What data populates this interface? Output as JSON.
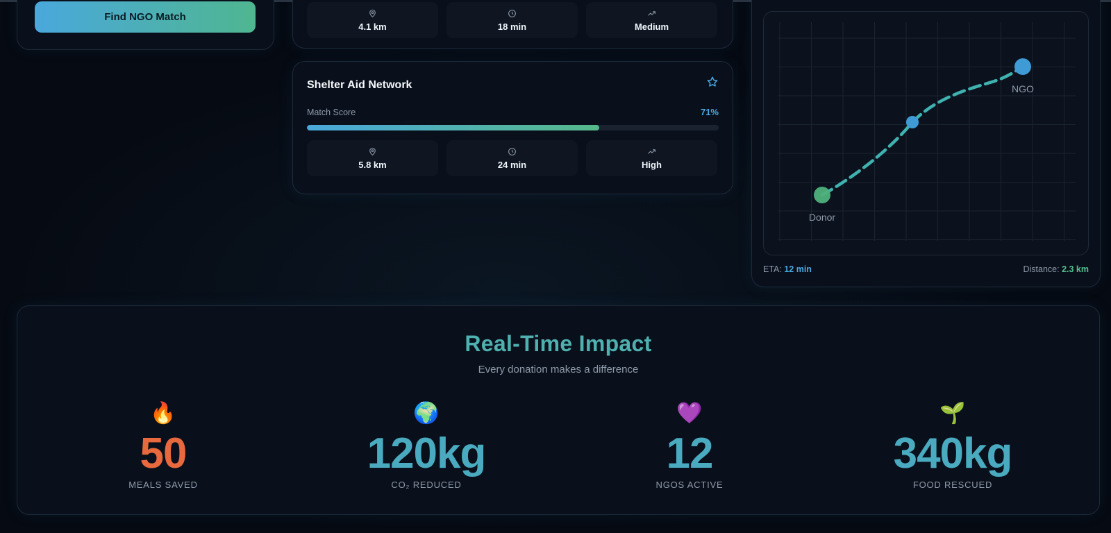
{
  "find_button": {
    "label": "Find NGO Match"
  },
  "match_cards": [
    {
      "metrics": [
        {
          "icon": "map-pin-icon",
          "value": "4.1 km"
        },
        {
          "icon": "clock-icon",
          "value": "18 min"
        },
        {
          "icon": "trending-up-icon",
          "value": "Medium"
        }
      ]
    },
    {
      "name": "Shelter Aid Network",
      "score_label": "Match Score",
      "score_text": "71%",
      "score_fraction": 0.71,
      "metrics": [
        {
          "icon": "map-pin-icon",
          "value": "5.8 km"
        },
        {
          "icon": "clock-icon",
          "value": "24 min"
        },
        {
          "icon": "trending-up-icon",
          "value": "High"
        }
      ]
    }
  ],
  "route": {
    "start_label": "Donor",
    "end_label": "NGO",
    "eta_label": "ETA:",
    "eta_value": "12 min",
    "distance_label": "Distance:",
    "distance_value": "2.3 km"
  },
  "impact": {
    "title": "Real-Time Impact",
    "subtitle": "Every donation makes a difference",
    "stats": [
      {
        "icon": "🔥",
        "value": "50",
        "label": "MEALS SAVED",
        "color": "#e8693e"
      },
      {
        "icon": "🌍",
        "value": "120kg",
        "label": "CO₂ REDUCED",
        "color": "#4aaac0"
      },
      {
        "icon": "💜",
        "value": "12",
        "label": "NGOS ACTIVE",
        "color": "#4aaac0"
      },
      {
        "icon": "🌱",
        "value": "340kg",
        "label": "FOOD RESCUED",
        "color": "#4aaac0"
      }
    ]
  },
  "colors": {
    "accent_blue": "#4aa8e0",
    "accent_green": "#52c08e",
    "accent_orange": "#e8693e",
    "accent_teal": "#4fb0b0"
  }
}
